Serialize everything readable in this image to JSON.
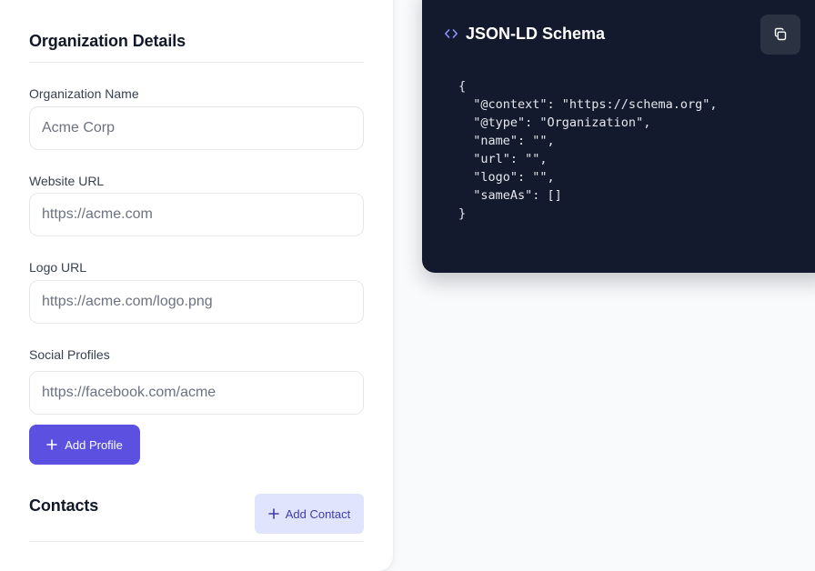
{
  "form": {
    "title": "Organization Details",
    "fields": [
      {
        "label": "Organization Name",
        "placeholder": "Acme Corp",
        "value": ""
      },
      {
        "label": "Website URL",
        "placeholder": "https://acme.com",
        "value": ""
      },
      {
        "label": "Logo URL",
        "placeholder": "https://acme.com/logo.png",
        "value": ""
      },
      {
        "label": "Social Profiles",
        "placeholder": "https://facebook.com/acme",
        "value": ""
      }
    ],
    "add_profile_label": "Add Profile",
    "contacts_title": "Contacts",
    "add_contact_label": "Add Contact"
  },
  "schema_panel": {
    "title": "JSON-LD Schema",
    "icon": "code-brackets-icon",
    "copy_icon": "copy-icon",
    "code_lines": [
      "{",
      "  \"@context\": \"https://schema.org\",",
      "  \"@type\": \"Organization\",",
      "  \"name\": \"\",",
      "  \"url\": \"\",",
      "  \"logo\": \"\",",
      "  \"sameAs\": []",
      "}"
    ]
  },
  "colors": {
    "primary": "#5b50e0",
    "secondary_bg": "#e0e4fc",
    "secondary_text": "#3f3cae",
    "code_bg": "#141a2e",
    "icon_accent": "#8b93ff"
  }
}
